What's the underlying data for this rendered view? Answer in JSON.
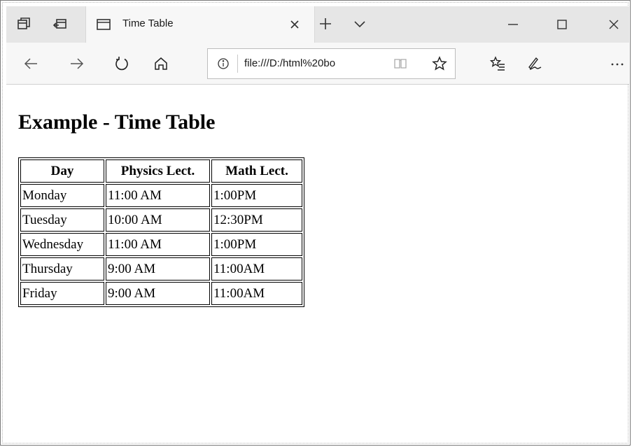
{
  "browser": {
    "tab": {
      "title": "Time Table"
    },
    "address": {
      "url": "file:///D:/html%20bo"
    },
    "icons": {
      "tab_actions": [
        "tabs-aside-icon",
        "restore-tabs-icon"
      ],
      "navigation": [
        "back-arrow-icon",
        "forward-arrow-icon",
        "refresh-icon",
        "home-icon"
      ],
      "right": [
        "favorites-icon",
        "pen-icon",
        "more-icon"
      ],
      "window": [
        "minimize-icon",
        "maximize-icon",
        "close-icon"
      ]
    }
  },
  "page": {
    "heading": "Example - Time Table",
    "table": {
      "headers": [
        "Day",
        "Physics Lect.",
        "Math Lect."
      ],
      "rows": [
        [
          "Monday",
          "11:00 AM",
          "1:00PM"
        ],
        [
          "Tuesday",
          "10:00 AM",
          "12:30PM"
        ],
        [
          "Wednesday",
          "11:00 AM",
          "1:00PM"
        ],
        [
          "Thursday",
          "9:00 AM",
          "11:00AM"
        ],
        [
          "Friday",
          "9:00 AM",
          "11:00AM"
        ]
      ]
    }
  }
}
